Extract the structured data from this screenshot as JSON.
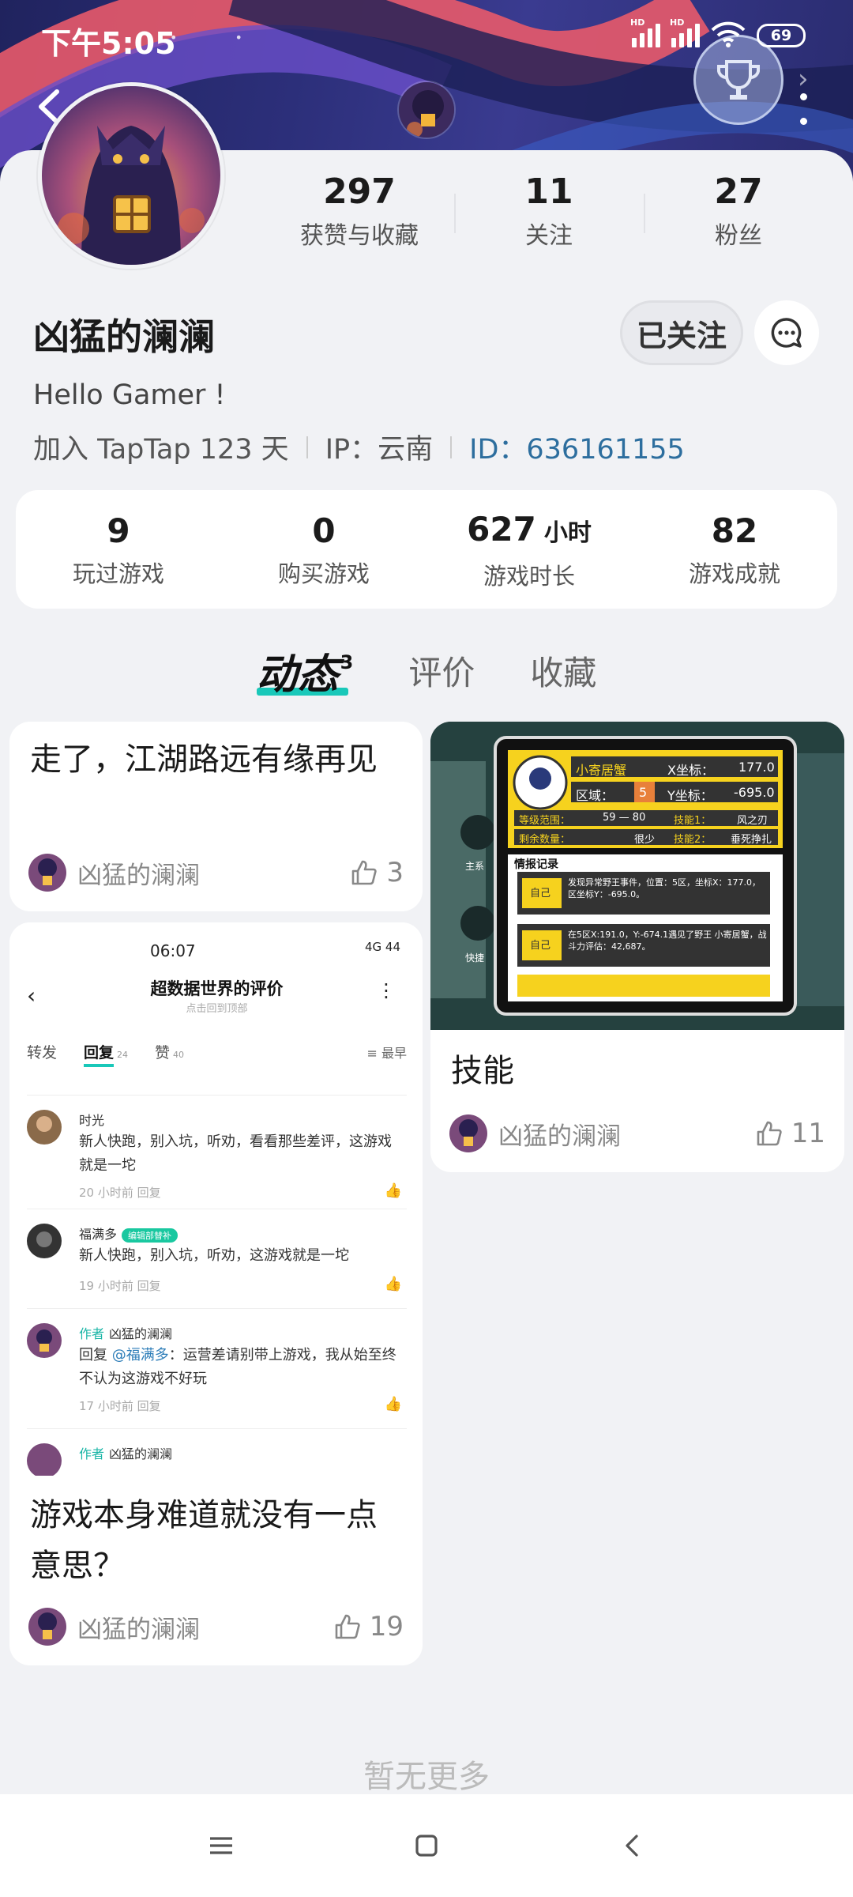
{
  "status": {
    "time": "下午5:05",
    "battery": "69",
    "hd1": "HD",
    "hd2": "HD"
  },
  "profile": {
    "stats": [
      {
        "num": "297",
        "label": "获赞与收藏"
      },
      {
        "num": "11",
        "label": "关注"
      },
      {
        "num": "27",
        "label": "粉丝"
      }
    ],
    "username": "凶猛的澜澜",
    "follow_label": "已关注",
    "bio": "Hello Gamer !",
    "join": "加入 TapTap 123 天",
    "ip": "IP：云南",
    "id": "ID：636161155"
  },
  "game_stats": [
    {
      "num": "9",
      "unit": "",
      "label": "玩过游戏"
    },
    {
      "num": "0",
      "unit": "",
      "label": "购买游戏"
    },
    {
      "num": "627",
      "unit": "小时",
      "label": "游戏时长"
    },
    {
      "num": "82",
      "unit": "",
      "label": "游戏成就"
    }
  ],
  "tabs": [
    {
      "label": "动态",
      "count": "3",
      "active": true
    },
    {
      "label": "评价",
      "active": false
    },
    {
      "label": "收藏",
      "active": false
    }
  ],
  "feed": [
    {
      "title": "走了，江湖路远有缘再见",
      "author": "凶猛的澜澜",
      "likes": "3"
    },
    {
      "title": "技能",
      "author": "凶猛的澜澜",
      "likes": "11"
    },
    {
      "title": "游戏本身难道就没有一点意思？",
      "author": "凶猛的澜澜",
      "likes": "19"
    }
  ],
  "shot": {
    "time": "06:07",
    "status": "4G 44",
    "title": "超数据世界的评价",
    "subtitle": "点击回到顶部",
    "tab_repost": "转发",
    "tab_reply": "回复",
    "tab_reply_count": "24",
    "tab_like": "赞",
    "tab_like_count": "40",
    "sort": "最早",
    "comments": [
      {
        "name": "时光",
        "text": "新人快跑，别入坑，听劝，看看那些差评，这游戏就是一坨",
        "meta": "20 小时前    回复"
      },
      {
        "name": "福满多",
        "pill": "编辑部替补",
        "text": "新人快跑，别入坑，听劝，这游戏就是一坨",
        "meta": "19 小时前    回复"
      },
      {
        "tag": "作者",
        "name": "凶猛的澜澜",
        "reply_prefix": "回复 ",
        "at": "@福满多",
        "text": "：运营差请别带上游戏，我从始至终不认为这游戏不好玩",
        "meta": "17 小时前    回复"
      },
      {
        "tag": "作者",
        "name": "凶猛的澜澜"
      }
    ]
  },
  "game_panel": {
    "name": "小寄居蟹",
    "x_label": "X坐标：",
    "x_val": "177.0",
    "zone_label": "区域：",
    "zone_val": "5",
    "y_label": "Y坐标：",
    "y_val": "-695.0",
    "range_label": "等级范围：",
    "range_val": "59 — 80",
    "skill1_label": "技能1：",
    "skill1_val": "风之刃",
    "remain_label": "剩余数量：",
    "remain_val": "很少",
    "skill2_label": "技能2：",
    "skill2_val": "垂死挣扎",
    "intel_title": "情报记录",
    "intel1_tag": "自己",
    "intel1": "发现异常野王事件，位置：5区，坐标X：177.0，区坐标Y：-695.0。",
    "intel2_tag": "自己",
    "intel2": "在5区X:191.0，Y:-674.1遇见了野王 小寄居蟹，战斗力评估：42,687。",
    "side1": "主系",
    "side2": "快捷"
  },
  "footer": {
    "no_more": "暂无更多"
  },
  "colors": {
    "accent": "#19c8b9",
    "id_blue": "#2d6e9e",
    "banner": "#2c2f7a"
  }
}
